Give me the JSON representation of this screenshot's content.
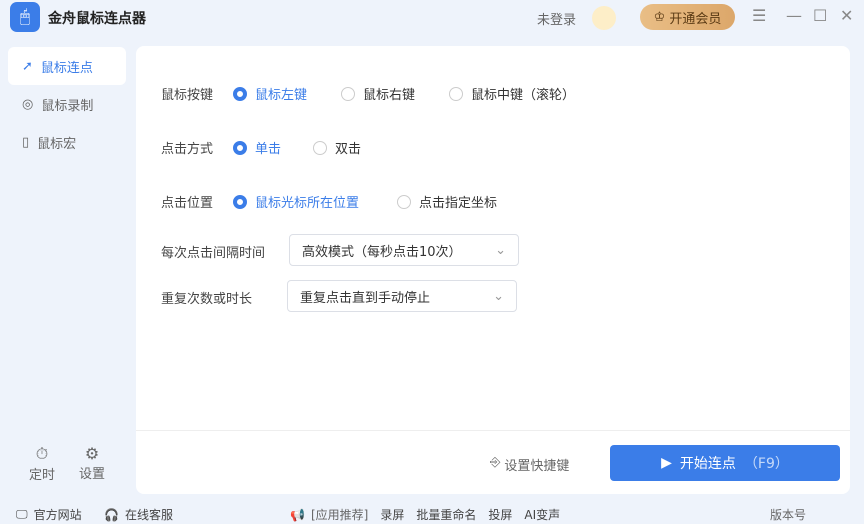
{
  "app": {
    "title": "金舟鼠标连点器",
    "login": "未登录",
    "vip": "开通会员"
  },
  "sidebar": {
    "items": [
      {
        "label": "鼠标连点"
      },
      {
        "label": "鼠标录制"
      },
      {
        "label": "鼠标宏"
      }
    ],
    "tools": [
      {
        "label": "定时"
      },
      {
        "label": "设置"
      }
    ]
  },
  "form": {
    "button": {
      "label": "鼠标按键",
      "options": [
        "鼠标左键",
        "鼠标右键",
        "鼠标中键（滚轮）"
      ],
      "selected": 0
    },
    "mode": {
      "label": "点击方式",
      "options": [
        "单击",
        "双击"
      ],
      "selected": 0
    },
    "position": {
      "label": "点击位置",
      "options": [
        "鼠标光标所在位置",
        "点击指定坐标"
      ],
      "selected": 0
    },
    "interval": {
      "label": "每次点击间隔时间",
      "value": "高效模式（每秒点击10次）"
    },
    "repeat": {
      "label": "重复次数或时长",
      "value": "重复点击直到手动停止"
    }
  },
  "actions": {
    "hotkey": "设置快捷键",
    "start": "开始连点",
    "start_key": "（F9）"
  },
  "footer": {
    "site": "官方网站",
    "service": "在线客服",
    "rec": "[应用推荐]",
    "links": [
      "录屏",
      "批量重命名",
      "投屏",
      "AI变声"
    ],
    "version": "版本号"
  }
}
